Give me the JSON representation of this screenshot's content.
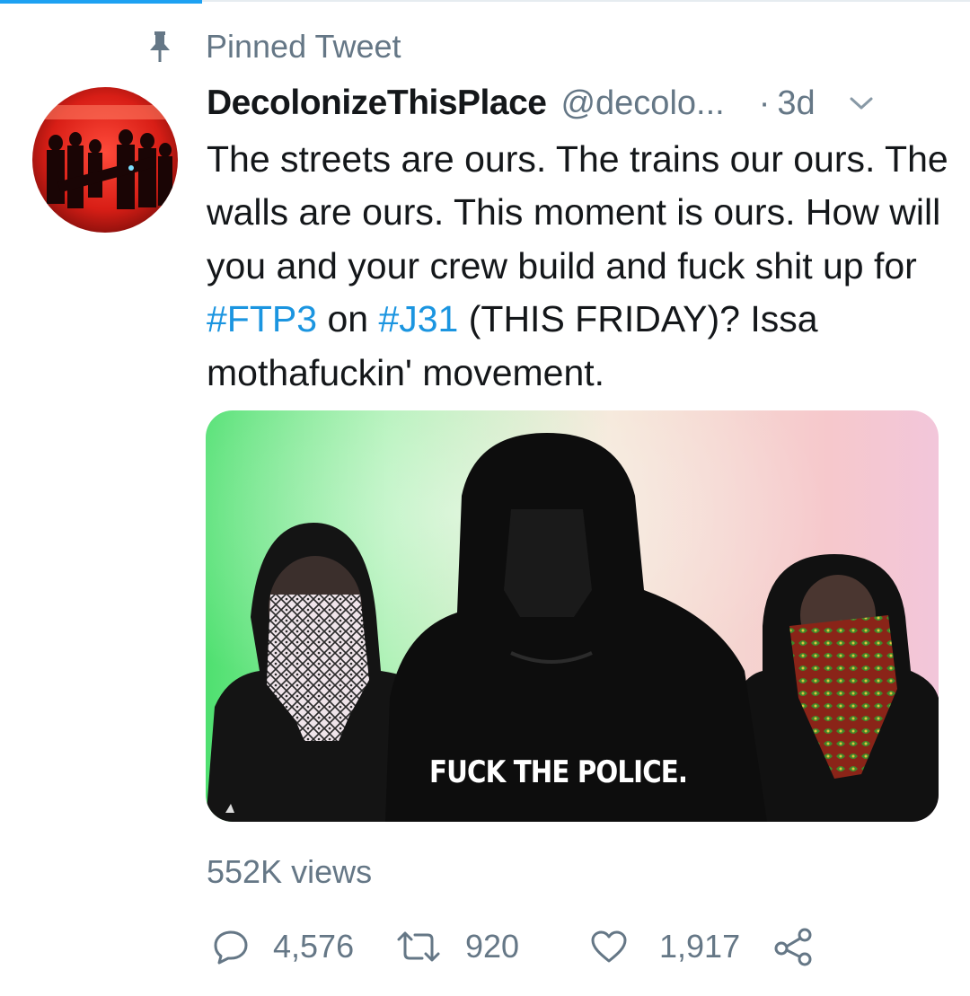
{
  "pinned": {
    "label": "Pinned Tweet",
    "icon": "pin-icon"
  },
  "tweet": {
    "display_name": "DecolonizeThisPlace",
    "handle": "@decolo...",
    "separator": "·",
    "time": "3d",
    "menu_icon": "chevron-down-icon",
    "text_parts": {
      "p1": "The streets are ours. The trains our ours. The walls are ours. This moment is ours. How will you and your crew build and fuck shit up for ",
      "tag1": "#FTP3",
      "p2": " on ",
      "tag2": "#J31",
      "p3": " (THIS FRIDAY)? Issa mothafuckin' movement."
    },
    "media": {
      "caption": "FUCK THE POLICE.",
      "views": "552K views"
    },
    "actions": {
      "reply_count": "4,576",
      "retweet_count": "920",
      "like_count": "1,917",
      "reply_icon": "reply-icon",
      "retweet_icon": "retweet-icon",
      "like_icon": "heart-icon",
      "share_icon": "share-icon"
    }
  },
  "colors": {
    "text_primary": "#14171a",
    "text_secondary": "#657786",
    "link": "#1b95e0",
    "accent": "#1da1f2"
  }
}
